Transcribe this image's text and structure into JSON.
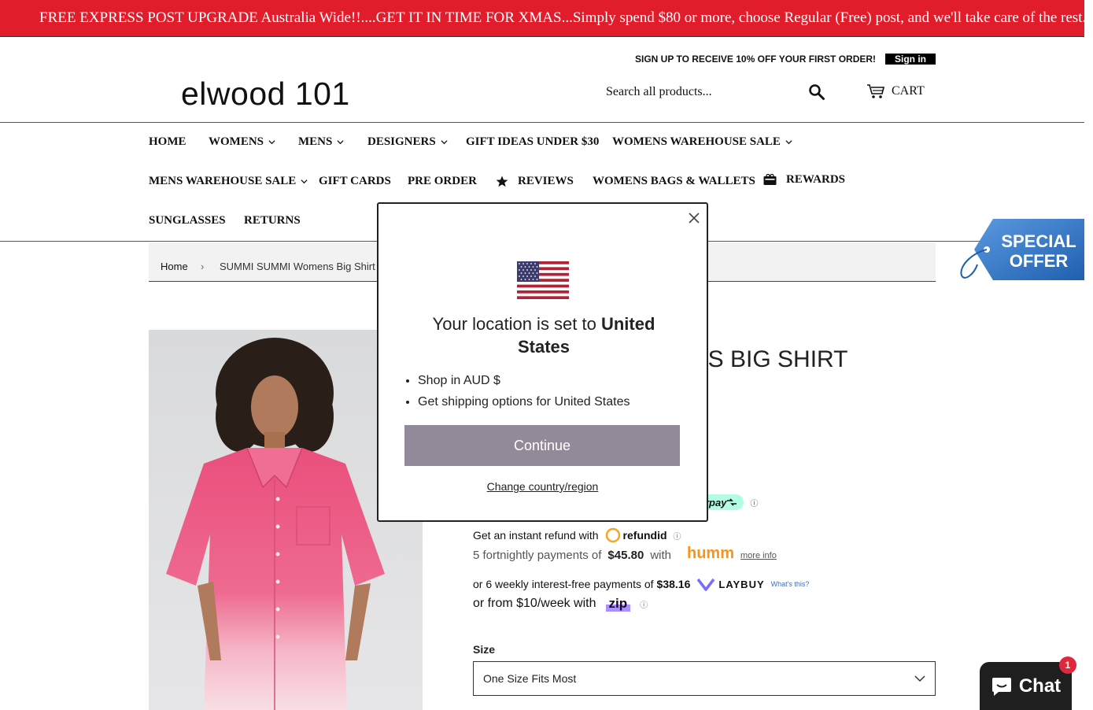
{
  "announcement": "FREE EXPRESS POST UPGRADE Australia Wide!!....GET IT IN TIME FOR XMAS...Simply spend $80 or more, choose Regular (Free) post, and we'll take care of the rest.....",
  "header": {
    "logo": "elwood 101",
    "signup": "SIGN UP TO RECEIVE 10% OFF YOUR FIRST ORDER!",
    "signin": "Sign in",
    "search_placeholder": "Search all products...",
    "cart": "CART"
  },
  "nav": {
    "items": [
      {
        "label": "HOME"
      },
      {
        "label": "WOMENS"
      },
      {
        "label": "MENS"
      },
      {
        "label": "DESIGNERS"
      },
      {
        "label": "GIFT IDEAS UNDER $30"
      },
      {
        "label": "WOMENS WAREHOUSE SALE"
      },
      {
        "label": "MENS WAREHOUSE SALE"
      },
      {
        "label": "GIFT CARDS"
      },
      {
        "label": "PRE ORDER"
      },
      {
        "label": "REVIEWS"
      },
      {
        "label": "WOMENS BAGS & WALLETS"
      },
      {
        "label": "REWARDS"
      },
      {
        "label": "SUNGLASSES"
      },
      {
        "label": "RETURNS"
      }
    ]
  },
  "breadcrumb": {
    "home": "Home",
    "separator": "›",
    "current": "SUMMI SUMMI Womens Big Shirt"
  },
  "special_offer": {
    "line1": "SPECIAL",
    "line2": "OFFER"
  },
  "product": {
    "title_visible": "ENS BIG SHIRT",
    "afterpay_fragment": "rpay",
    "refundid_text": "Get an instant refund with",
    "refundid_brand": "refundid",
    "humm_text": "5 fortnightly payments of",
    "humm_amount": "$45.80",
    "humm_with": "with",
    "humm_brand": "humm",
    "humm_more": "more info",
    "laybuy_text": "or 6 weekly interest-free payments of",
    "laybuy_amount": "$38.16",
    "laybuy_brand": "LAYBUY",
    "laybuy_whats": "What's this?",
    "zip_text": "or from $10/week with",
    "zip_brand": "zip",
    "info_glyph": "ⓘ",
    "size_label": "Size",
    "size_value": "One Size Fits Most"
  },
  "modal": {
    "title_prefix": "Your location is set to",
    "country": "United States",
    "bullets": [
      "Shop in AUD $",
      "Get shipping options for United States"
    ],
    "continue": "Continue",
    "change": "Change country/region"
  },
  "chat": {
    "label": "Chat",
    "badge": "1"
  },
  "colors": {
    "announcement_bg": "#e21d2b",
    "continue_bg": "#928a98",
    "chat_bg": "#1f1f1f",
    "badge_bg": "#e0283c",
    "humm_orange": "#f7941d",
    "laybuy_purple": "#786dff"
  }
}
